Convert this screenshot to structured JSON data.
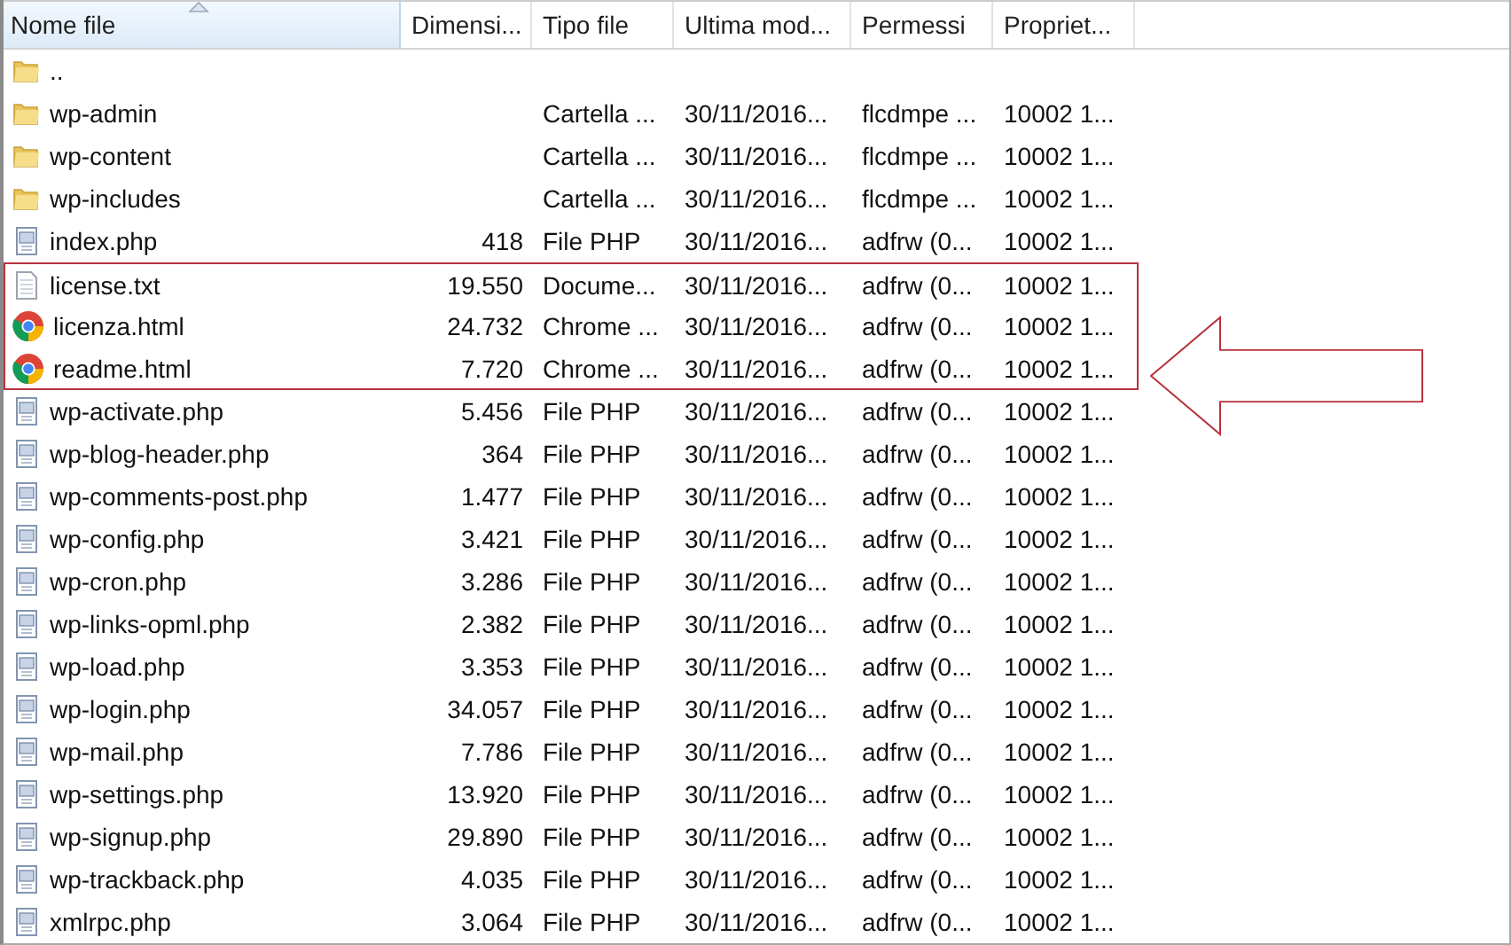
{
  "columns": [
    {
      "label": "Nome file",
      "sorted": true
    },
    {
      "label": "Dimensi...",
      "sorted": false
    },
    {
      "label": "Tipo file",
      "sorted": false
    },
    {
      "label": "Ultima mod...",
      "sorted": false
    },
    {
      "label": "Permessi",
      "sorted": false
    },
    {
      "label": "Propriet...",
      "sorted": false
    }
  ],
  "rows": [
    {
      "kind": "folder",
      "name": "..",
      "marked": false
    },
    {
      "kind": "folder",
      "name": "wp-admin",
      "type": "Cartella ...",
      "modified": "30/11/2016...",
      "permissions": "flcdmpe ...",
      "owner": "10002 1...",
      "marked": false
    },
    {
      "kind": "folder",
      "name": "wp-content",
      "type": "Cartella ...",
      "modified": "30/11/2016...",
      "permissions": "flcdmpe ...",
      "owner": "10002 1...",
      "marked": false
    },
    {
      "kind": "folder",
      "name": "wp-includes",
      "type": "Cartella ...",
      "modified": "30/11/2016...",
      "permissions": "flcdmpe ...",
      "owner": "10002 1...",
      "marked": false
    },
    {
      "kind": "php",
      "name": "index.php",
      "size": "418",
      "type": "File PHP",
      "modified": "30/11/2016...",
      "permissions": "adfrw (0...",
      "owner": "10002 1...",
      "marked": false
    },
    {
      "kind": "text",
      "name": "license.txt",
      "size": "19.550",
      "type": "Docume...",
      "modified": "30/11/2016...",
      "permissions": "adfrw (0...",
      "owner": "10002 1...",
      "marked": true
    },
    {
      "kind": "chrome",
      "name": "licenza.html",
      "size": "24.732",
      "type": "Chrome ...",
      "modified": "30/11/2016...",
      "permissions": "adfrw (0...",
      "owner": "10002 1...",
      "marked": true
    },
    {
      "kind": "chrome",
      "name": "readme.html",
      "size": "7.720",
      "type": "Chrome ...",
      "modified": "30/11/2016...",
      "permissions": "adfrw (0...",
      "owner": "10002 1...",
      "marked": true
    },
    {
      "kind": "php",
      "name": "wp-activate.php",
      "size": "5.456",
      "type": "File PHP",
      "modified": "30/11/2016...",
      "permissions": "adfrw (0...",
      "owner": "10002 1...",
      "marked": false
    },
    {
      "kind": "php",
      "name": "wp-blog-header.php",
      "size": "364",
      "type": "File PHP",
      "modified": "30/11/2016...",
      "permissions": "adfrw (0...",
      "owner": "10002 1...",
      "marked": false
    },
    {
      "kind": "php",
      "name": "wp-comments-post.php",
      "size": "1.477",
      "type": "File PHP",
      "modified": "30/11/2016...",
      "permissions": "adfrw (0...",
      "owner": "10002 1...",
      "marked": false
    },
    {
      "kind": "php",
      "name": "wp-config.php",
      "size": "3.421",
      "type": "File PHP",
      "modified": "30/11/2016...",
      "permissions": "adfrw (0...",
      "owner": "10002 1...",
      "marked": false
    },
    {
      "kind": "php",
      "name": "wp-cron.php",
      "size": "3.286",
      "type": "File PHP",
      "modified": "30/11/2016...",
      "permissions": "adfrw (0...",
      "owner": "10002 1...",
      "marked": false
    },
    {
      "kind": "php",
      "name": "wp-links-opml.php",
      "size": "2.382",
      "type": "File PHP",
      "modified": "30/11/2016...",
      "permissions": "adfrw (0...",
      "owner": "10002 1...",
      "marked": false
    },
    {
      "kind": "php",
      "name": "wp-load.php",
      "size": "3.353",
      "type": "File PHP",
      "modified": "30/11/2016...",
      "permissions": "adfrw (0...",
      "owner": "10002 1...",
      "marked": false
    },
    {
      "kind": "php",
      "name": "wp-login.php",
      "size": "34.057",
      "type": "File PHP",
      "modified": "30/11/2016...",
      "permissions": "adfrw (0...",
      "owner": "10002 1...",
      "marked": false
    },
    {
      "kind": "php",
      "name": "wp-mail.php",
      "size": "7.786",
      "type": "File PHP",
      "modified": "30/11/2016...",
      "permissions": "adfrw (0...",
      "owner": "10002 1...",
      "marked": false
    },
    {
      "kind": "php",
      "name": "wp-settings.php",
      "size": "13.920",
      "type": "File PHP",
      "modified": "30/11/2016...",
      "permissions": "adfrw (0...",
      "owner": "10002 1...",
      "marked": false
    },
    {
      "kind": "php",
      "name": "wp-signup.php",
      "size": "29.890",
      "type": "File PHP",
      "modified": "30/11/2016...",
      "permissions": "adfrw (0...",
      "owner": "10002 1...",
      "marked": false
    },
    {
      "kind": "php",
      "name": "wp-trackback.php",
      "size": "4.035",
      "type": "File PHP",
      "modified": "30/11/2016...",
      "permissions": "adfrw (0...",
      "owner": "10002 1...",
      "marked": false
    },
    {
      "kind": "php",
      "name": "xmlrpc.php",
      "size": "3.064",
      "type": "File PHP",
      "modified": "30/11/2016...",
      "permissions": "adfrw (0...",
      "owner": "10002 1...",
      "marked": false
    }
  ]
}
